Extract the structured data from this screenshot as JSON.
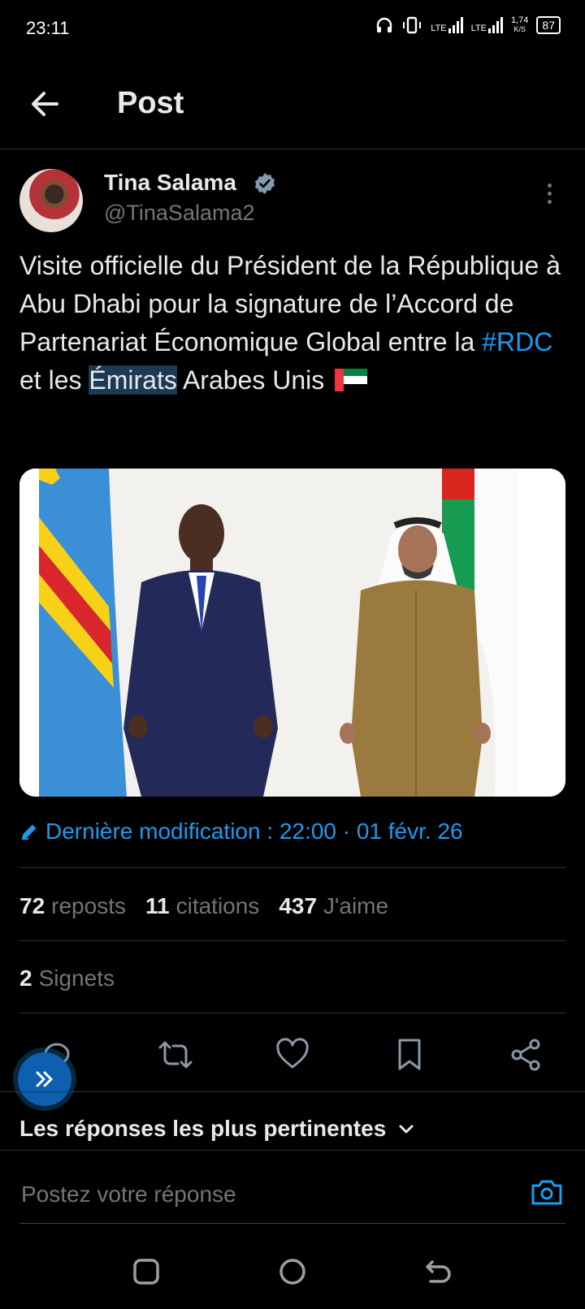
{
  "status_bar": {
    "time": "23:11",
    "net1": "LTE",
    "net2": "LTE",
    "speed": "1,74",
    "speed_unit": "K/S",
    "battery": "87"
  },
  "header": {
    "title": "Post",
    "back_icon": "arrow-left-icon"
  },
  "author": {
    "name": "Tina Salama",
    "handle": "@TinaSalama2",
    "verified": true
  },
  "tweet": {
    "text_part1": "Visite officielle du Président de la République à Abu Dhabi pour la signature de l’Accord de Partenariat Économique Global entre la ",
    "hashtag": "#RDC",
    "text_part2": " et les ",
    "highlighted": "Émirats",
    "text_part3": " Arabes Unis ",
    "flag": "UAE-flag"
  },
  "edited": {
    "label": "Dernière modification : 22:00 · 01 févr. 26",
    "icon": "pencil-icon"
  },
  "stats": {
    "reposts_count": "72",
    "reposts_label": "reposts",
    "quotes_count": "11",
    "quotes_label": "citations",
    "likes_count": "437",
    "likes_label": "J'aime",
    "bookmarks_count": "2",
    "bookmarks_label": "Signets"
  },
  "actions": [
    "reply-icon",
    "repost-icon",
    "like-icon",
    "bookmark-icon",
    "share-icon"
  ],
  "replies": {
    "sort_label": "Les réponses les plus pertinentes",
    "input_placeholder": "Postez votre réponse"
  },
  "colors": {
    "accent": "#1d9bf0",
    "muted": "#71767b",
    "background": "#000000",
    "divider": "#2f3336"
  }
}
